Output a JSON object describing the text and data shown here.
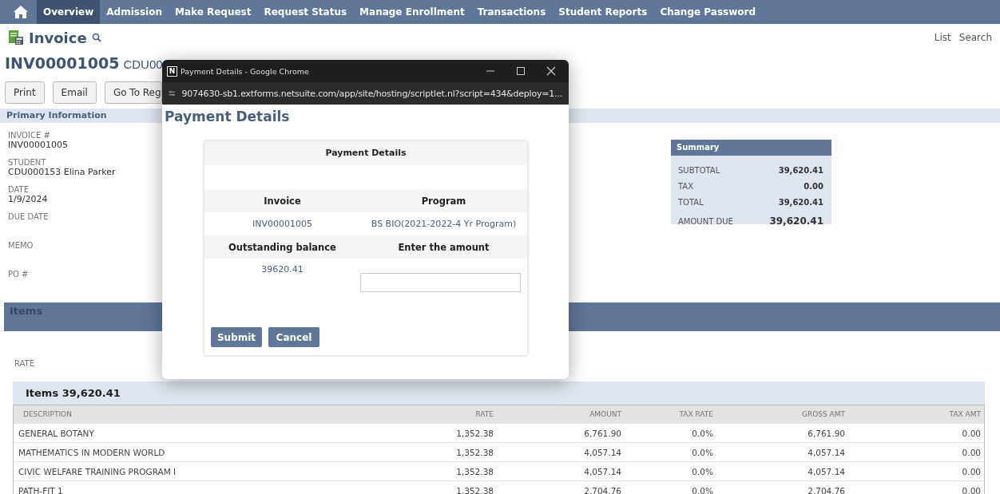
{
  "nav": {
    "items": [
      {
        "label": "Overview",
        "selected": true
      },
      {
        "label": "Admission",
        "selected": false
      },
      {
        "label": "Make Request",
        "selected": false
      },
      {
        "label": "Request Status",
        "selected": false
      },
      {
        "label": "Manage Enrollment",
        "selected": false
      },
      {
        "label": "Transactions",
        "selected": false
      },
      {
        "label": "Student Reports",
        "selected": false
      },
      {
        "label": "Change Password",
        "selected": false
      }
    ]
  },
  "page": {
    "title": "Invoice",
    "links": [
      "List",
      "Search"
    ],
    "record_number": "INV00001005",
    "record_name": "CDU00",
    "buttons": [
      "Print",
      "Email",
      "Go To Reg"
    ],
    "section": "Primary Information"
  },
  "fields": [
    {
      "label": "INVOICE #",
      "value": "INV00001005"
    },
    {
      "label": "STUDENT",
      "value": "CDU000153 Elina Parker"
    },
    {
      "label": "DATE",
      "value": "1/9/2024"
    },
    {
      "label": "DUE DATE"
    },
    {
      "label": "MEMO"
    },
    {
      "label": "PO #"
    }
  ],
  "summary": {
    "title": "Summary",
    "rows": [
      {
        "label": "SUBTOTAL",
        "value": "39,620.41"
      },
      {
        "label": "TAX",
        "value": "0.00"
      },
      {
        "label": "TOTAL",
        "value": "39,620.41"
      },
      {
        "label": "AMOUNT DUE",
        "value": "39,620.41"
      }
    ]
  },
  "items_bar": {
    "title": "Items"
  },
  "rate_label": "RATE",
  "items_table": {
    "title": "Items 39,620.41",
    "columns": [
      "DESCRIPTION",
      "RATE",
      "AMOUNT",
      "TAX RATE",
      "GROSS AMT",
      "TAX AMT"
    ],
    "rows": [
      [
        "GENERAL BOTANY",
        "1,352.38",
        "6,761.90",
        "0.0%",
        "6,761.90",
        "0.00"
      ],
      [
        "MATHEMATICS IN MODERN WORLD",
        "1,352.38",
        "4,057.14",
        "0.0%",
        "4,057.14",
        "0.00"
      ],
      [
        "CIVIC WELFARE TRAINING PROGRAM I",
        "1,352.38",
        "4,057.14",
        "0.0%",
        "4,057.14",
        "0.00"
      ],
      [
        "PATH-FIT 1",
        "1,352.38",
        "2,704.76",
        "0.0%",
        "2,704.76",
        "0.00"
      ]
    ]
  },
  "popup": {
    "favicon_letter": "N",
    "window_title": "Payment Details - Google Chrome",
    "url": "9074630-sb1.extforms.netsuite.com/app/site/hosting/scriptlet.nl?script=434&deploy=1...",
    "heading": "Payment Details",
    "card": {
      "title": "Payment Details",
      "headers_1": [
        "Invoice",
        "Program"
      ],
      "values_1": [
        "INV00001005",
        "BS BIO(2021-2022-4 Yr Program)"
      ],
      "headers_2": [
        "Outstanding balance",
        "Enter the amount"
      ],
      "balance": "39620.41",
      "buttons": [
        "Submit",
        "Cancel"
      ]
    }
  }
}
